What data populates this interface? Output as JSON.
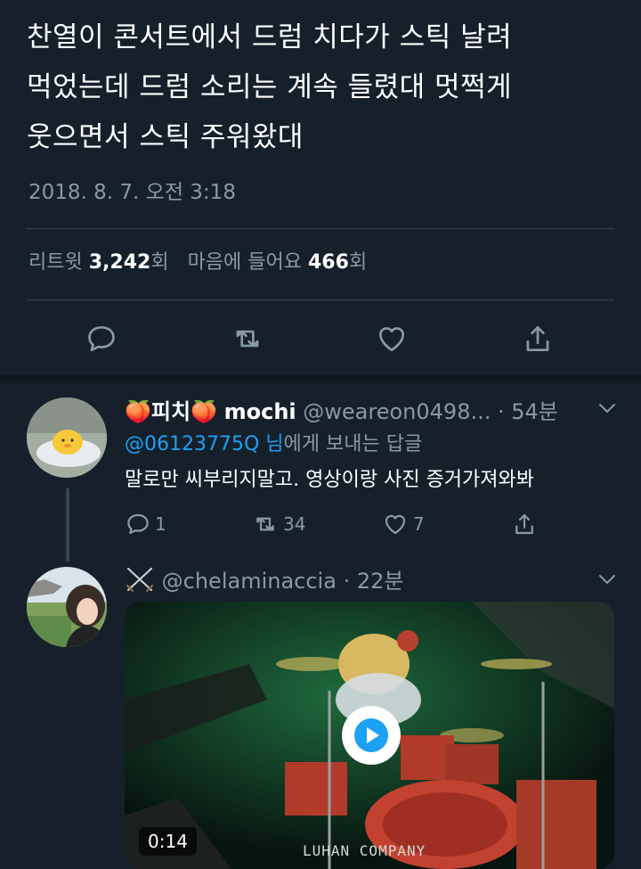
{
  "tweet": {
    "text_lines": [
      "찬열이 콘서트에서 드럼 치다가 스틱 날려",
      "먹었는데 드럼 소리는 계속 들렸대 멋쩍게",
      "웃으면서 스틱 주워왔대"
    ],
    "timestamp": "2018. 8. 7. 오전 3:18",
    "retweet_label": "리트윗",
    "retweet_count": "3,242",
    "retweet_unit": "회",
    "like_label": "마음에 들어요",
    "like_count": "466",
    "like_unit": "회"
  },
  "reply1": {
    "name_emoji_left": "🍑",
    "name_korean": "피치",
    "name_emoji_right": "🍑",
    "name_latin": "mochi",
    "handle": "@weareon0498...",
    "time": "· 54분",
    "reply_to_mention": "@06123775Q",
    "reply_to_suffix_1": " 님",
    "reply_to_suffix_2": "에게 보내는 답글",
    "text": "말로만 씨부리지말고. 영상이랑 사진 증거가져와봐",
    "reply_count": "1",
    "retweet_count": "34",
    "like_count": "7"
  },
  "reply2": {
    "handle": "@chelaminaccia",
    "time": "· 22분",
    "video_duration": "0:14",
    "video_watermark": "LUHAN COMPANY"
  },
  "colors": {
    "background": "#15202b",
    "secondary_text": "#8899a6",
    "accent": "#1da1f2",
    "divider": "#38444d"
  }
}
